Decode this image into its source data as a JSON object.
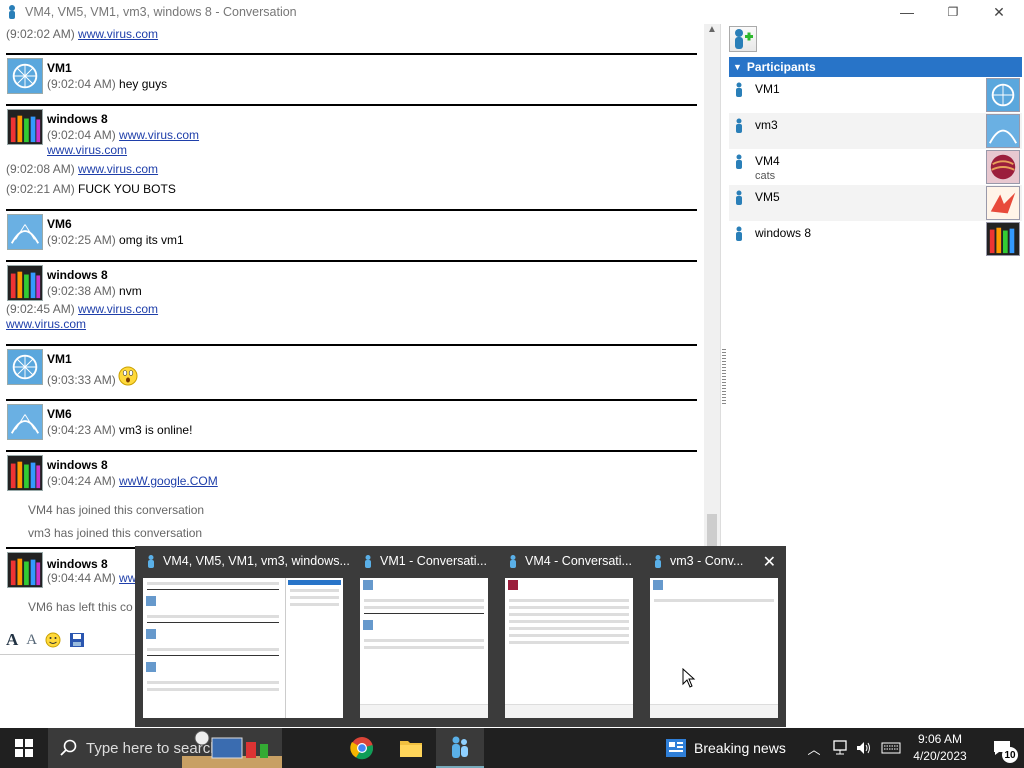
{
  "window": {
    "title": "VM4, VM5, VM1, vm3, windows 8 - Conversation",
    "minimize_glyph": "—",
    "maximize_glyph": "❐",
    "close_glyph": "✕"
  },
  "chat": {
    "entries": [
      {
        "ts": "(9:02:02 AM)",
        "link": "www.virus.com"
      },
      {
        "sender": "VM1",
        "ts": "(9:02:04 AM)",
        "text": "hey guys"
      },
      {
        "sender": "windows 8",
        "ts": "(9:02:04 AM)",
        "link": "www.virus.com",
        "link2": "www.virus.com"
      },
      {
        "ts": "(9:02:08 AM)",
        "link": "www.virus.com"
      },
      {
        "ts": "(9:02:21 AM)",
        "text": "FUCK YOU BOTS"
      },
      {
        "sender": "VM6",
        "ts": "(9:02:25 AM)",
        "text": "omg its vm1"
      },
      {
        "sender": "windows 8",
        "ts": "(9:02:38 AM)",
        "text": "nvm"
      },
      {
        "ts": "(9:02:45 AM)",
        "link": "www.virus.com",
        "link2": "www.virus.com"
      },
      {
        "sender": "VM1",
        "ts": "(9:03:33 AM)"
      },
      {
        "sender": "VM6",
        "ts": "(9:04:23 AM)",
        "text": "vm3 is online!"
      },
      {
        "sender": "windows 8",
        "ts": "(9:04:24 AM)",
        "link": "wwW.google.COM"
      },
      {
        "system": "VM4 has joined this conversation"
      },
      {
        "system": "vm3 has joined this conversation"
      },
      {
        "sender": "windows 8",
        "ts": "(9:04:44 AM)",
        "link": "www.google.co"
      },
      {
        "system": "VM6 has left this co"
      }
    ]
  },
  "participants": {
    "header": "Participants",
    "items": [
      {
        "name": "VM1",
        "status": ""
      },
      {
        "name": "vm3",
        "status": ""
      },
      {
        "name": "VM4",
        "status": "cats"
      },
      {
        "name": "VM5",
        "status": ""
      },
      {
        "name": "windows 8",
        "status": ""
      }
    ]
  },
  "preview": {
    "windows": [
      {
        "title": "VM4, VM5, VM1, vm3, windows..."
      },
      {
        "title": "VM1 - Conversati..."
      },
      {
        "title": "VM4 - Conversati..."
      },
      {
        "title": "vm3 - Conv..."
      }
    ],
    "close_glyph": "✕"
  },
  "taskbar": {
    "search_placeholder": "Type here to search",
    "news": "Breaking news",
    "time": "9:06 AM",
    "date": "4/20/2023",
    "notifications": "10"
  }
}
